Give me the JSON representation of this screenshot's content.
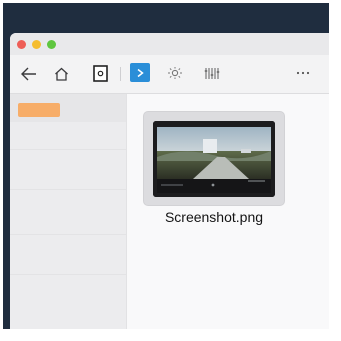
{
  "window": {
    "controls": [
      "close",
      "minimize",
      "maximize"
    ]
  },
  "toolbar": {
    "buttons": [
      {
        "name": "back",
        "icon": "arrow-left-icon"
      },
      {
        "name": "home",
        "icon": "home-icon"
      },
      {
        "name": "document",
        "icon": "document-icon"
      },
      {
        "name": "play",
        "icon": "play-icon"
      },
      {
        "name": "brightness",
        "icon": "sun-icon"
      },
      {
        "name": "adjustments",
        "icon": "sliders-icon"
      },
      {
        "name": "more",
        "icon": "more-dots-icon"
      }
    ],
    "accent": "#2a8ed8"
  },
  "sidebar": {
    "selected_tag_color": "#f7ad68"
  },
  "files": [
    {
      "name": "Screenshot.png",
      "icon": "image-thumbnail"
    }
  ]
}
